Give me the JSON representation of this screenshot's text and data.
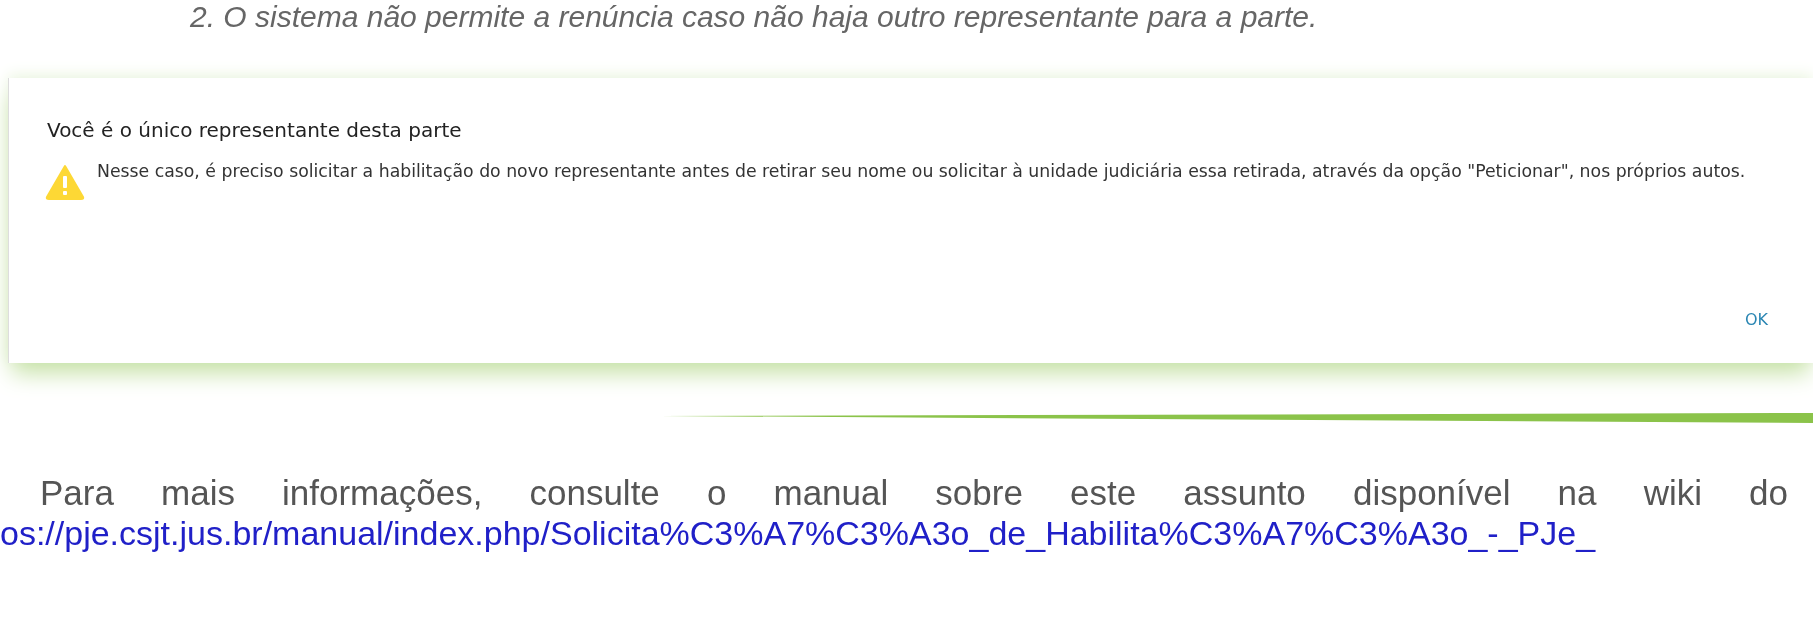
{
  "heading": "2. O sistema não permite a renúncia caso não haja outro representante para a parte.",
  "dialog": {
    "title": "Você é o único representante desta parte",
    "message": "Nesse caso, é preciso solicitar a habilitação do novo representante antes de retirar seu nome ou solicitar à unidade judiciária essa retirada, através da opção \"Peticionar\", nos próprios autos.",
    "button": "OK"
  },
  "paragraph": {
    "text": "Para mais informações, consulte o manual sobre este assunto disponível na wiki do",
    "link": "os://pje.csjt.jus.br/manual/index.php/Solicita%C3%A7%C3%A3o_de_Habilita%C3%A7%C3%A3o_-_PJe_"
  }
}
